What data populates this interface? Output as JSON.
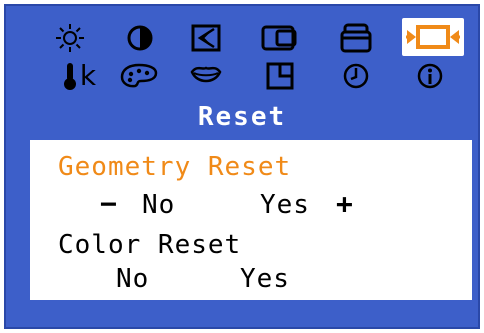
{
  "menu": {
    "title": "Reset",
    "icons_row1": [
      "brightness-icon",
      "contrast-icon",
      "position-icon",
      "size-icon",
      "image-setup-icon",
      "image-reset-icon"
    ],
    "icons_row2": [
      "color-temperature-icon",
      "color-palette-icon",
      "color-effect-icon",
      "pip-icon",
      "clock-icon",
      "information-icon"
    ],
    "selected_icon": "image-reset-icon",
    "accent_color": "#f08a18",
    "background_color": "#3d5fc9"
  },
  "geometry_reset": {
    "label": "Geometry Reset",
    "minus": "−",
    "no": "No",
    "yes": "Yes",
    "plus": "+"
  },
  "color_reset": {
    "label": "Color Reset",
    "no": "No",
    "yes": "Yes"
  },
  "labels": {
    "temperature_k": "k"
  }
}
